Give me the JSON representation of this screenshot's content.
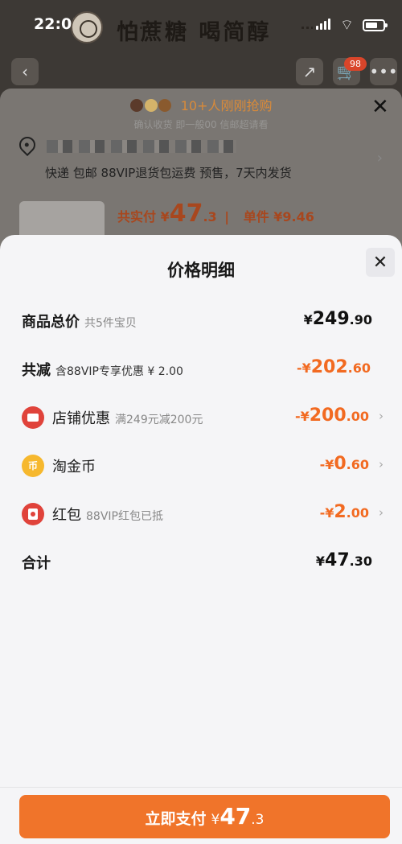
{
  "status_bar": {
    "time": "22:03",
    "banner_text": "怕蔗糖 喝简醇"
  },
  "background": {
    "cart_count": "98",
    "popular_text": "10+人刚刚抢购",
    "popular_sub": "确认收货 即一般00 信邮超请看",
    "shipping": "快递 包邮 88VIP退货包运费 预售，7天内发货",
    "pay_label": "共实付 ¥",
    "pay_int": "47",
    "pay_dec": ".3",
    "unit_label": "单件 ¥9.46",
    "separator": "|"
  },
  "sheet": {
    "title": "价格明细",
    "rows": [
      {
        "label": "商品总价",
        "note": "共5件宝贝",
        "cur": "¥",
        "int": "249",
        "dec": ".90"
      },
      {
        "label": "共减",
        "note": "含88VIP专享优惠 ¥ 2.00",
        "cur": "-¥",
        "int": "202",
        "dec": ".60"
      },
      {
        "label": "店铺优惠",
        "note": "满249元减200元",
        "cur": "-¥",
        "int": "200",
        "dec": ".00",
        "chevron": "›"
      },
      {
        "label": "淘金币",
        "note": "",
        "cur": "-¥",
        "int": "0",
        "dec": ".60",
        "chevron": "›",
        "icon_text": "币"
      },
      {
        "label": "红包",
        "note": "88VIP红包已抵",
        "cur": "-¥",
        "int": "2",
        "dec": ".00",
        "chevron": "›"
      },
      {
        "label": "合计",
        "note": "",
        "cur": "¥",
        "int": "47",
        "dec": ".30"
      }
    ]
  },
  "pay_button": {
    "label": "立即支付",
    "cur": "¥",
    "int": "47",
    "dec": ".3"
  },
  "icons": {
    "back": "chevron-left-icon",
    "share": "share-icon",
    "cart": "cart-icon",
    "more": "more-icon",
    "close": "close-icon"
  },
  "colors": {
    "accent": "#f26a21",
    "button": "#f0742a",
    "red_icon": "#e0433b",
    "coin": "#f6b82e"
  }
}
